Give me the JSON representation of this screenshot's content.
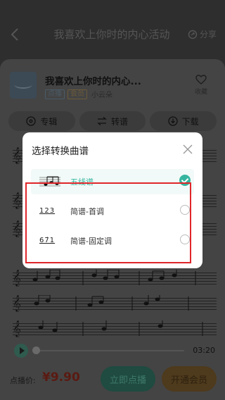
{
  "header": {
    "title": "我喜欢上你时的内心活动",
    "share_label": "分享"
  },
  "song": {
    "title": "我喜欢上你时的内心...",
    "tags": [
      "点播",
      "会员"
    ],
    "artist": "小云朵",
    "favorite_label": "收藏"
  },
  "actions": [
    {
      "label": "专辑",
      "icon": "album-icon"
    },
    {
      "label": "转谱",
      "icon": "swap-icon"
    },
    {
      "label": "下载",
      "icon": "download-icon"
    }
  ],
  "player": {
    "progress": 0.0,
    "duration": "03:20"
  },
  "purchase": {
    "price_label": "点播价:",
    "price": "¥9.90",
    "buy_label": "立即点播",
    "vip_label": "开通会员"
  },
  "modal": {
    "title": "选择转换曲谱",
    "options": [
      {
        "label": "五线谱",
        "thumb": "staff-notation-icon",
        "selected": true
      },
      {
        "label": "简谱-首调",
        "thumb_text": "123",
        "selected": false
      },
      {
        "label": "简谱-固定调",
        "thumb_text": "67̇1",
        "selected": false
      }
    ]
  },
  "colors": {
    "accent": "#35b5a0",
    "price": "#e0262a",
    "highlight": "#e0262a",
    "vip": "#f2a93b"
  }
}
